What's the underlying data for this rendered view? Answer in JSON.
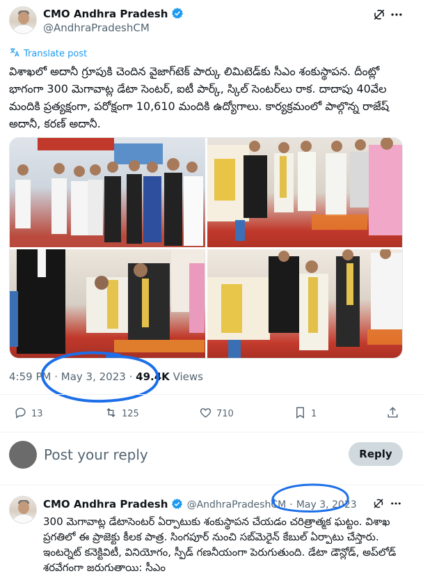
{
  "tweet": {
    "author_name": "CMO Andhra Pradesh",
    "author_handle": "@AndhraPradeshCM",
    "translate_label": "Translate post",
    "text": "విశాఖలో అదానీ గ్రూపుకి చెందిన వైజాగ్‌టెక్ పార్కు లిమిటెడ్‌కు సీఎం శంకుస్థాపన. దీంట్లో భాగంగా 300 మెగావాట్ల డేటా సెంటర్, ఐటీ పార్క్, స్కిల్ సెంటర్‌లు రాక. దాదాపు 40వేల మందికి ప్రత్యక్షంగా, పరోక్షంగా 10,610 మందికి ఉద్యోగాలు. కార్యక్రమంలో పాల్గొన్న రాజేష్ అదానీ, కరణ్ అదానీ.",
    "time": "4:59 PM",
    "date": "May 3, 2023",
    "views_count": "49.4K",
    "views_label": "Views",
    "replies": "13",
    "reposts": "125",
    "likes": "710",
    "bookmarks": "1"
  },
  "reply_box": {
    "placeholder": "Post your reply",
    "button_label": "Reply"
  },
  "reply_tweet": {
    "author_name": "CMO Andhra Pradesh",
    "author_handle": "@AndhraPradeshCM",
    "separator": "·",
    "date": "May 3, 2023",
    "text": "300 మెగావాట్ల డేటాసెంటర్ ఏర్పాటుకు శంకుస్థాపన చేయడం చరిత్రాత్మక ఘట్టం. విశాఖ ప్రగతిలో ఈ ప్రాజెక్టు కీలక పాత్ర. సింగపూర్ నుంచి సబ్‌మెరైన్ కేబుల్ ఏర్పాటు చేస్తారు. ఇంటర్నెట్ కనెక్టివిటీ, వినియోగం, స్పీడ్ గణనీయంగా పెరుగుతుంది. డేటా డౌన్లోడ్, అప్‌లోడ్ శరవేగంగా జరుగుతాయి: సీఎం"
  },
  "colors": {
    "verified": "#1d9bf0",
    "link": "#1d9bf0",
    "secondary_text": "#536471",
    "annotation_ink": "#1c6fe8"
  },
  "icons": [
    "grok-icon",
    "more-icon",
    "verified-badge-icon",
    "translate-icon",
    "reply-icon",
    "repost-icon",
    "like-icon",
    "bookmark-icon",
    "share-icon"
  ]
}
